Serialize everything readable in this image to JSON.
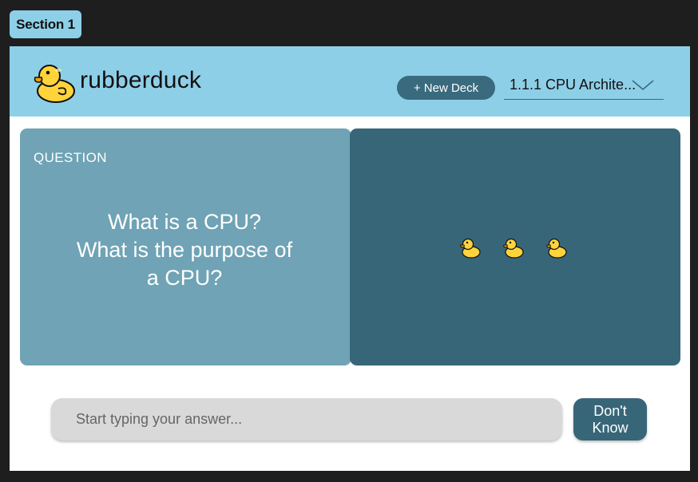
{
  "section_tag": "Section 1",
  "header": {
    "brand": "rubberduck",
    "logo_icon": "rubber-duck-icon",
    "new_deck_label": "+ New Deck",
    "deck_select": {
      "value": "1.1.1 CPU Archite...",
      "icon": "chevron-down-icon"
    }
  },
  "question_card": {
    "label": "QUESTION",
    "lines": [
      "What is a CPU?",
      "What is the purpose of",
      "a CPU?"
    ]
  },
  "answer_card": {
    "loading_icons": [
      "rubber-duck-icon",
      "rubber-duck-icon",
      "rubber-duck-icon"
    ]
  },
  "answer_input": {
    "placeholder": "Start typing your answer...",
    "value": ""
  },
  "dont_know_button": {
    "line1": "Don't",
    "line2": "Know"
  },
  "colors": {
    "background": "#1e1e1e",
    "header": "#8ecfe8",
    "primary": "#3a6a7e",
    "question_card": "#6fa3b5",
    "answer_card": "#376678",
    "input": "#d9d9d9"
  }
}
